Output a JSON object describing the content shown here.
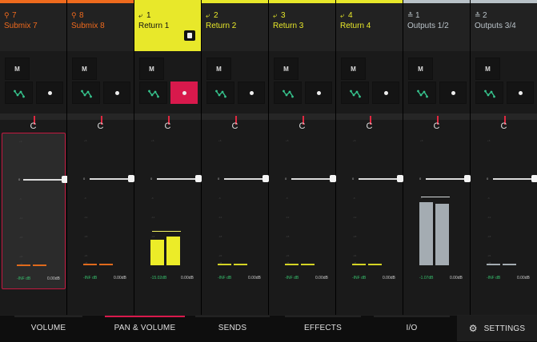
{
  "channels": [
    {
      "id": "submix-7",
      "type_icon": "submix-icon",
      "glyph": "⚲",
      "number": "7",
      "name": "Submix 7",
      "color": "#ef6a1d",
      "strip": "#ef6a1d",
      "selected": false,
      "mute_label": "M",
      "record_armed": false,
      "pan": "C",
      "fader_selected_frame": true,
      "meter": [
        0,
        0
      ],
      "meter_color": "#e06a1c",
      "peak": null,
      "level_readout": "-INF dB",
      "gain_readout": "0.00dB"
    },
    {
      "id": "submix-8",
      "type_icon": "submix-icon",
      "glyph": "⚲",
      "number": "8",
      "name": "Submix 8",
      "color": "#ef6a1d",
      "strip": "#ef6a1d",
      "selected": false,
      "mute_label": "M",
      "record_armed": false,
      "pan": "C",
      "fader_selected_frame": false,
      "meter": [
        0,
        0
      ],
      "meter_color": "#e06a1c",
      "peak": null,
      "level_readout": "-INF dB",
      "gain_readout": "0.00dB"
    },
    {
      "id": "return-1",
      "type_icon": "return-icon",
      "glyph": "⤶",
      "number": "1",
      "name": "Return 1",
      "color": "#111111",
      "strip": "#e8e82a",
      "selected": true,
      "mute_label": "M",
      "record_armed": true,
      "pan": "C",
      "fader_selected_frame": false,
      "meter": [
        0.23,
        0.26
      ],
      "meter_color": "#ecec28",
      "peak": 0.31,
      "level_readout": "-15.02dB",
      "gain_readout": "0.00dB"
    },
    {
      "id": "return-2",
      "type_icon": "return-icon",
      "glyph": "⤶",
      "number": "2",
      "name": "Return 2",
      "color": "#e8e82a",
      "strip": "#e8e82a",
      "selected": false,
      "mute_label": "M",
      "record_armed": false,
      "pan": "C",
      "fader_selected_frame": false,
      "meter": [
        0,
        0
      ],
      "meter_color": "#d4d424",
      "peak": null,
      "level_readout": "-INF dB",
      "gain_readout": "0.00dB"
    },
    {
      "id": "return-3",
      "type_icon": "return-icon",
      "glyph": "⤶",
      "number": "3",
      "name": "Return 3",
      "color": "#e8e82a",
      "strip": "#e8e82a",
      "selected": false,
      "mute_label": "M",
      "record_armed": false,
      "pan": "C",
      "fader_selected_frame": false,
      "meter": [
        0,
        0
      ],
      "meter_color": "#d4d424",
      "peak": null,
      "level_readout": "-INF dB",
      "gain_readout": "0.00dB"
    },
    {
      "id": "return-4",
      "type_icon": "return-icon",
      "glyph": "⤶",
      "number": "4",
      "name": "Return 4",
      "color": "#e8e82a",
      "strip": "#e8e82a",
      "selected": false,
      "mute_label": "M",
      "record_armed": false,
      "pan": "C",
      "fader_selected_frame": false,
      "meter": [
        0,
        0
      ],
      "meter_color": "#d4d424",
      "peak": null,
      "level_readout": "-INF dB",
      "gain_readout": "0.00dB"
    },
    {
      "id": "outputs-1-2",
      "type_icon": "output-icon",
      "glyph": "≛",
      "number": "1",
      "name": "Outputs 1/2",
      "color": "#b9c2c8",
      "strip": "#b9c2c8",
      "selected": false,
      "mute_label": "M",
      "record_armed": false,
      "pan": "C",
      "fader_selected_frame": false,
      "meter": [
        0.57,
        0.56
      ],
      "meter_color": "#a4acb2",
      "peak": 0.62,
      "level_readout": "-1.07dB",
      "gain_readout": "0.00dB"
    },
    {
      "id": "outputs-3-4",
      "type_icon": "output-icon",
      "glyph": "≛",
      "number": "2",
      "name": "Outputs 3/4",
      "color": "#b9c2c8",
      "strip": "#b9c2c8",
      "selected": false,
      "mute_label": "M",
      "record_armed": false,
      "pan": "C",
      "fader_selected_frame": false,
      "meter": [
        0,
        0
      ],
      "meter_color": "#a4acb2",
      "peak": null,
      "level_readout": "-INF dB",
      "gain_readout": "0.00dB"
    }
  ],
  "tabs": [
    {
      "label": "VOLUME",
      "active": false
    },
    {
      "label": "PAN & VOLUME",
      "active": true
    },
    {
      "label": "SENDS",
      "active": false
    },
    {
      "label": "EFFECTS",
      "active": false
    },
    {
      "label": "I/O",
      "active": false
    },
    {
      "label": "SETTINGS",
      "active": false,
      "icon": "gear-icon"
    }
  ],
  "colors": {
    "accent": "#d8194c",
    "automation_icon": "#36c28c",
    "readout_green": "#37c06d"
  }
}
